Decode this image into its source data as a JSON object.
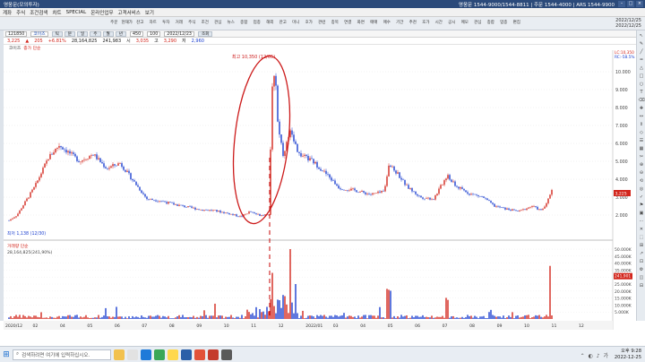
{
  "window": {
    "title": "영웅문(모의투자)",
    "phones": "영웅문 1544-9000/1544-8811 | 주문 1544-4000 | ARS 1544-9900"
  },
  "menu": [
    "계좌",
    "주식",
    "조건검색",
    "차트",
    "SPECIAL",
    "온라인업무",
    "고객서비스",
    "보기"
  ],
  "toolbar": {
    "buttons": [
      "주문",
      "현재가",
      "잔고",
      "차트",
      "투자",
      "거래",
      "주식",
      "조건",
      "관심",
      "뉴스",
      "종합",
      "업종",
      "해외",
      "잔고",
      "미니",
      "호가",
      "관련",
      "종목",
      "연결",
      "화면",
      "매매",
      "매수",
      "기간",
      "추천",
      "호가",
      "시간",
      "공시",
      "메모",
      "관심",
      "종합",
      "업종",
      "편집"
    ],
    "clock_time": "2022/12/25",
    "clock_sub": "2022/12/25"
  },
  "chart_toolbar": {
    "code": "121850",
    "name": "코이즈",
    "tf_labels": [
      "틱",
      "분",
      "일",
      "주",
      "월",
      "년"
    ],
    "count": "450",
    "period": "100",
    "date": "2022/12/23",
    "btn_query": "조회"
  },
  "quote": {
    "price": "3,225",
    "change_arrow": "▲",
    "change": "205",
    "change_pct": "+6.81%",
    "volume": "28,164,825",
    "amount": "241,983",
    "open_label": "시",
    "open": "3,035",
    "high_label": "고",
    "high": "3,290",
    "low_label": "저",
    "low": "2,960"
  },
  "indicators": {
    "price_label": "코이즈",
    "ma_label": "종가 단순",
    "volume_label": "거래량 단순",
    "volume_info": "28,164,825(241,90%)"
  },
  "annotations": {
    "high": "최고 10,350 (12/05)",
    "low": "최저 1,138 (12/30)"
  },
  "axis": {
    "price_ticks": [
      "10.000",
      "9.000",
      "8.000",
      "7.000",
      "6.000",
      "5.000",
      "4.000",
      "3.000",
      "2.000"
    ],
    "volume_ticks": [
      "50.000K",
      "45.000K",
      "40.000K",
      "35.000K",
      "30.000K",
      "25.000K",
      "20.000K",
      "15.000K",
      "10.000K",
      "5.000K"
    ],
    "x_labels": [
      "2020/12",
      "02",
      "04",
      "05",
      "06",
      "07",
      "08",
      "09",
      "10",
      "11",
      "12",
      "2022/01",
      "03",
      "04",
      "05",
      "06",
      "07",
      "08",
      "09",
      "10",
      "11",
      "12"
    ],
    "current_price": "3,225",
    "current_volume": "241,901",
    "axis_top_labels": [
      "LC:10,350",
      "RC:-58.5%"
    ]
  },
  "taskbar": {
    "search_placeholder": "검색하려면 여기에 입력하십시오.",
    "time": "오후 9:28",
    "date": "2022-12-25"
  },
  "colors": {
    "up": "#d2261c",
    "down": "#1b3fcf",
    "annotation": "#cc1a1a"
  }
}
